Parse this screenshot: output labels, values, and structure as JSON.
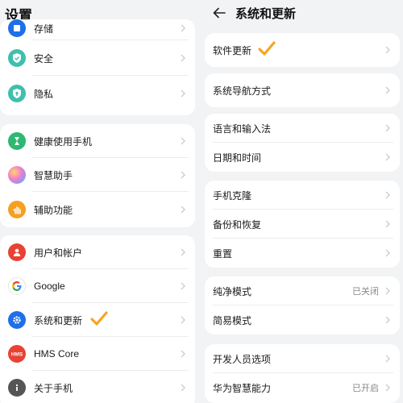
{
  "left": {
    "title": "设置",
    "group1": [
      {
        "label": "存储",
        "icon": "storage-icon"
      },
      {
        "label": "安全",
        "icon": "shield-check-icon"
      },
      {
        "label": "隐私",
        "icon": "privacy-shield-icon"
      }
    ],
    "group2": [
      {
        "label": "健康使用手机",
        "icon": "hourglass-icon"
      },
      {
        "label": "智慧助手",
        "icon": "assistant-orb-icon"
      },
      {
        "label": "辅助功能",
        "icon": "hand-icon"
      }
    ],
    "group3": [
      {
        "label": "用户和帐户",
        "icon": "user-icon"
      },
      {
        "label": "Google",
        "icon": "google-icon"
      },
      {
        "label": "系统和更新",
        "icon": "gear-icon"
      },
      {
        "label": "HMS Core",
        "icon": "hms-icon"
      },
      {
        "label": "关于手机",
        "icon": "info-icon"
      }
    ]
  },
  "right": {
    "title": "系统和更新",
    "groups": [
      [
        {
          "label": "软件更新"
        }
      ],
      [
        {
          "label": "系统导航方式"
        }
      ],
      [
        {
          "label": "语言和输入法"
        },
        {
          "label": "日期和时间"
        }
      ],
      [
        {
          "label": "手机克隆"
        },
        {
          "label": "备份和恢复"
        },
        {
          "label": "重置"
        }
      ],
      [
        {
          "label": "纯净模式",
          "value": "已关闭"
        },
        {
          "label": "简易模式"
        }
      ],
      [
        {
          "label": "开发人员选项"
        },
        {
          "label": "华为智慧能力",
          "value": "已开启"
        }
      ]
    ]
  },
  "colors": {
    "background": "#f1f3f5",
    "card": "#ffffff",
    "checkmark": "#f5a623",
    "blue": "#1e6fe8",
    "teal": "#3fbfae",
    "green": "#2eb872",
    "orange": "#f5a020",
    "red": "#e84234",
    "gray": "#555555"
  }
}
